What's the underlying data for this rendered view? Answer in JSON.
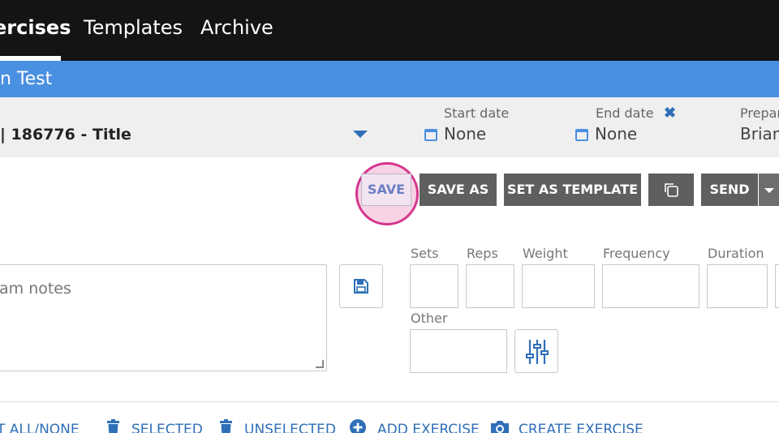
{
  "nav": {
    "tabs": [
      {
        "label": "ercises",
        "active": true
      },
      {
        "label": "Templates",
        "active": false
      },
      {
        "label": "Archive",
        "active": false
      }
    ]
  },
  "title_bar": {
    "text": "n Test"
  },
  "program": {
    "title": "| 186776 - Title"
  },
  "start_date": {
    "label": "Start date",
    "value": "None"
  },
  "end_date": {
    "label": "End date",
    "value": "None"
  },
  "prepared_by": {
    "label": "Prepar",
    "value": "Brian"
  },
  "actions": {
    "save": "SAVE",
    "save_as": "SAVE AS",
    "set_as_template": "SET AS TEMPLATE",
    "send": "SEND"
  },
  "notes": {
    "placeholder": "am notes"
  },
  "params": {
    "sets": "Sets",
    "reps": "Reps",
    "weight": "Weight",
    "frequency": "Frequency",
    "duration": "Duration",
    "other": "Other"
  },
  "bottom_actions": {
    "select_all": "T ALL/NONE",
    "delete_selected": "SELECTED",
    "delete_unselected": "UNSELECTED",
    "add_exercise": "ADD EXERCISE",
    "create_exercise": "CREATE EXERCISE"
  },
  "colors": {
    "nav_bg": "#141414",
    "title_bar": "#4a90e2",
    "accent": "#2f6fb8",
    "highlight": "#d6348e"
  }
}
